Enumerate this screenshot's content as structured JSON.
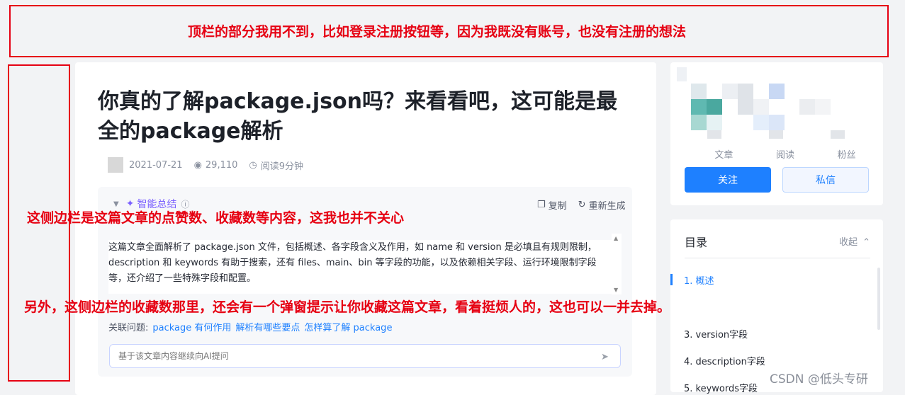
{
  "annotations": {
    "top": "顶栏的部分我用不到，比如登录注册按钮等，因为我既没有账号，也没有注册的想法",
    "left_mid": "这侧边栏是这篇文章的点赞数、收藏数等内容，这我也并不关心",
    "left_bottom": "另外，这侧边栏的收藏数那里，还会有一个弹窗提示让你收藏这篇文章，看着挺烦人的，这也可以一并去掉。"
  },
  "article": {
    "title": "你真的了解package.json吗？来看看吧，这可能是最全的package解析",
    "date": "2021-07-21",
    "views": "29,110",
    "read_time": "阅读9分钟"
  },
  "ai_summary": {
    "label": "智能总结",
    "copy": "复制",
    "regenerate": "重新生成",
    "text": "这篇文章全面解析了 package.json 文件，包括概述、各字段含义及作用，如 name 和 version 是必填且有规则限制，description 和 keywords 有助于搜索，还有 files、main、bin 等字段的功能，以及依赖相关字段、运行环境限制字段等，还介绍了一些特殊字段和配置。",
    "related_label": "关联问题:",
    "related": [
      "package 有何作用",
      "解析有哪些要点",
      "怎样算了解 package"
    ],
    "input_placeholder": "基于该文章内容继续向AI提问"
  },
  "author": {
    "stats": [
      "文章",
      "阅读",
      "粉丝"
    ],
    "follow": "关注",
    "message": "私信"
  },
  "toc": {
    "title": "目录",
    "toggle": "收起",
    "items": [
      "1. 概述",
      "3. version字段",
      "4. description字段",
      "5. keywords字段"
    ]
  },
  "watermark": "CSDN @低头专研",
  "colors": {
    "annotation": "#e60012",
    "accent": "#1e80ff"
  }
}
